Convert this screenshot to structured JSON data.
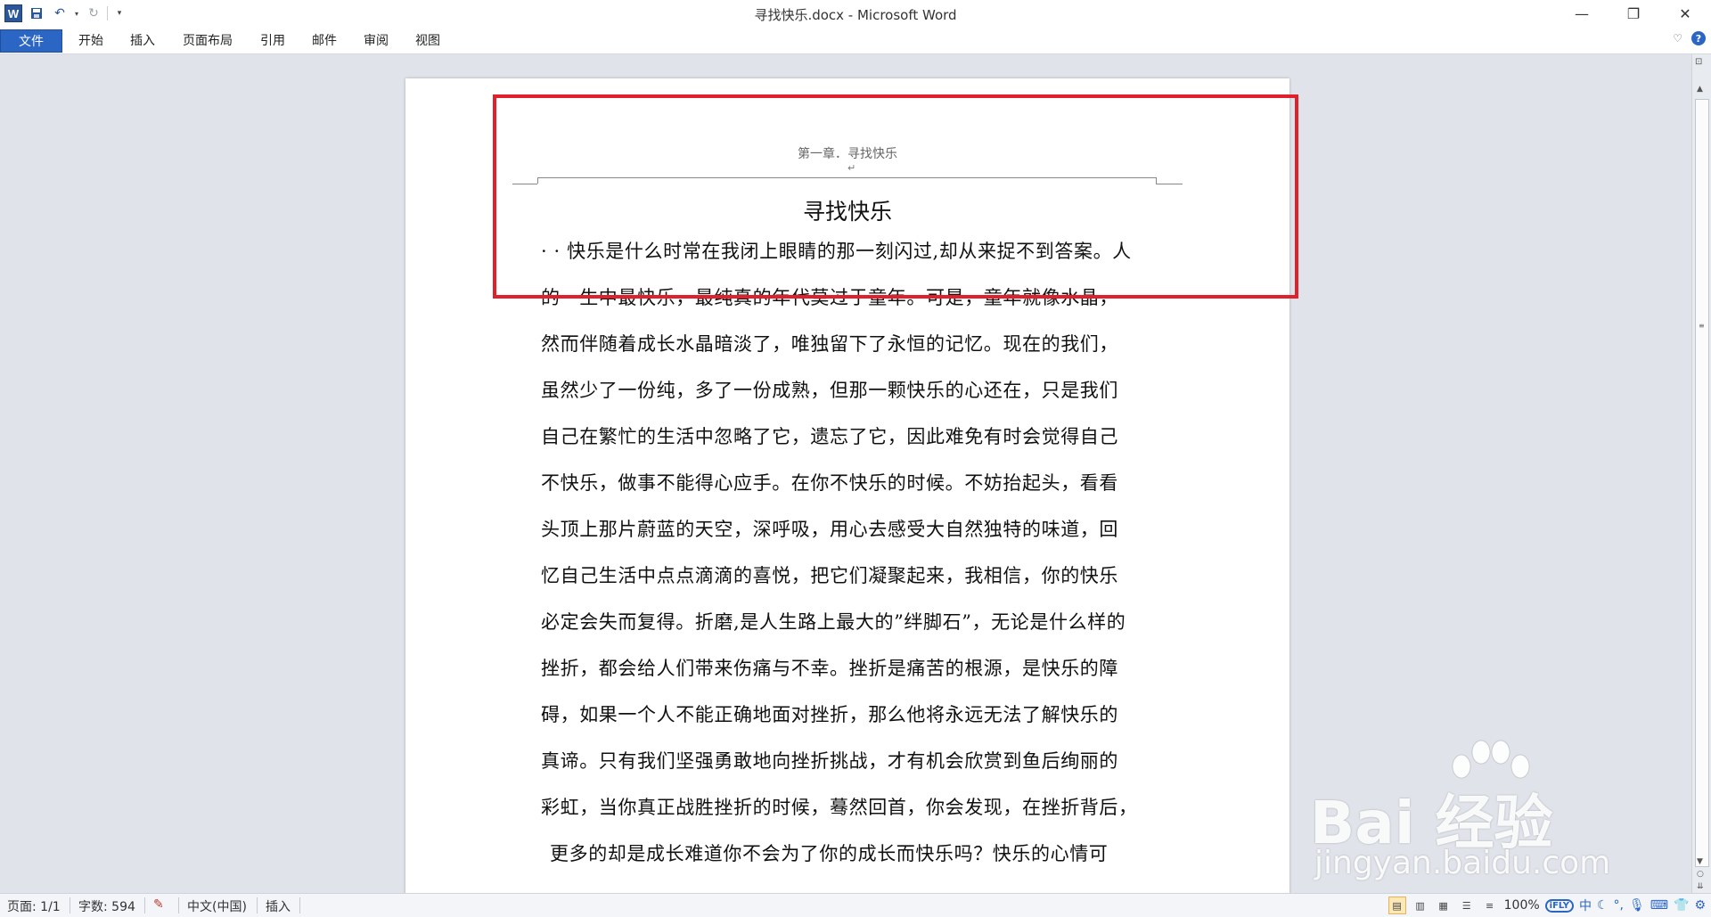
{
  "app": {
    "window_title": "寻找快乐.docx - Microsoft Word",
    "logo_letter": "W"
  },
  "ribbon": {
    "tabs": [
      {
        "label": "文件"
      },
      {
        "label": "开始"
      },
      {
        "label": "插入"
      },
      {
        "label": "页面布局"
      },
      {
        "label": "引用"
      },
      {
        "label": "邮件"
      },
      {
        "label": "审阅"
      },
      {
        "label": "视图"
      }
    ],
    "help_label": "?"
  },
  "document": {
    "header_text": "第一章．寻找快乐",
    "title": "寻找快乐",
    "lines": [
      "· · 快乐是什么时常在我闭上眼睛的那一刻闪过,却从来捉不到答案。人",
      "的一生中最快乐，最纯真的年代莫过于童年。可是，童年就像水晶，",
      "然而伴随着成长水晶暗淡了，唯独留下了永恒的记忆。现在的我们，",
      "虽然少了一份纯，多了一份成熟，但那一颗快乐的心还在，只是我们",
      "自己在繁忙的生活中忽略了它，遗忘了它，因此难免有时会觉得自己",
      "不快乐，做事不能得心应手。在你不快乐的时候。不妨抬起头，看看",
      "头顶上那片蔚蓝的天空，深呼吸，用心去感受大自然独特的味道，回",
      "忆自己生活中点点滴滴的喜悦，把它们凝聚起来，我相信，你的快乐",
      "必定会失而复得。折磨,是人生路上最大的”绊脚石”，无论是什么样的",
      "挫折，都会给人们带来伤痛与不幸。挫折是痛苦的根源，是快乐的障",
      "碍，如果一个人不能正确地面对挫折，那么他将永远无法了解快乐的",
      "真谛。只有我们坚强勇敢地向挫折挑战，才有机会欣赏到鱼后绚丽的",
      "彩虹，当你真正战胜挫折的时候，蓦然回首，你会发现，在挫折背后，",
      "更多的却是成长难道你不会为了你的成长而快乐吗？快乐的心情可"
    ]
  },
  "statusbar": {
    "page": "页面: 1/1",
    "words": "字数: 594",
    "language": "中文(中国)",
    "mode": "插入",
    "zoom": "100%",
    "ime_badge": "iFLY",
    "ime_lang": "中"
  },
  "watermark": {
    "brand": "Bai 经验",
    "url": "jingyan.baidu.com"
  },
  "colors": {
    "file_tab": "#2b66c4",
    "highlight_box": "#e0202a"
  }
}
